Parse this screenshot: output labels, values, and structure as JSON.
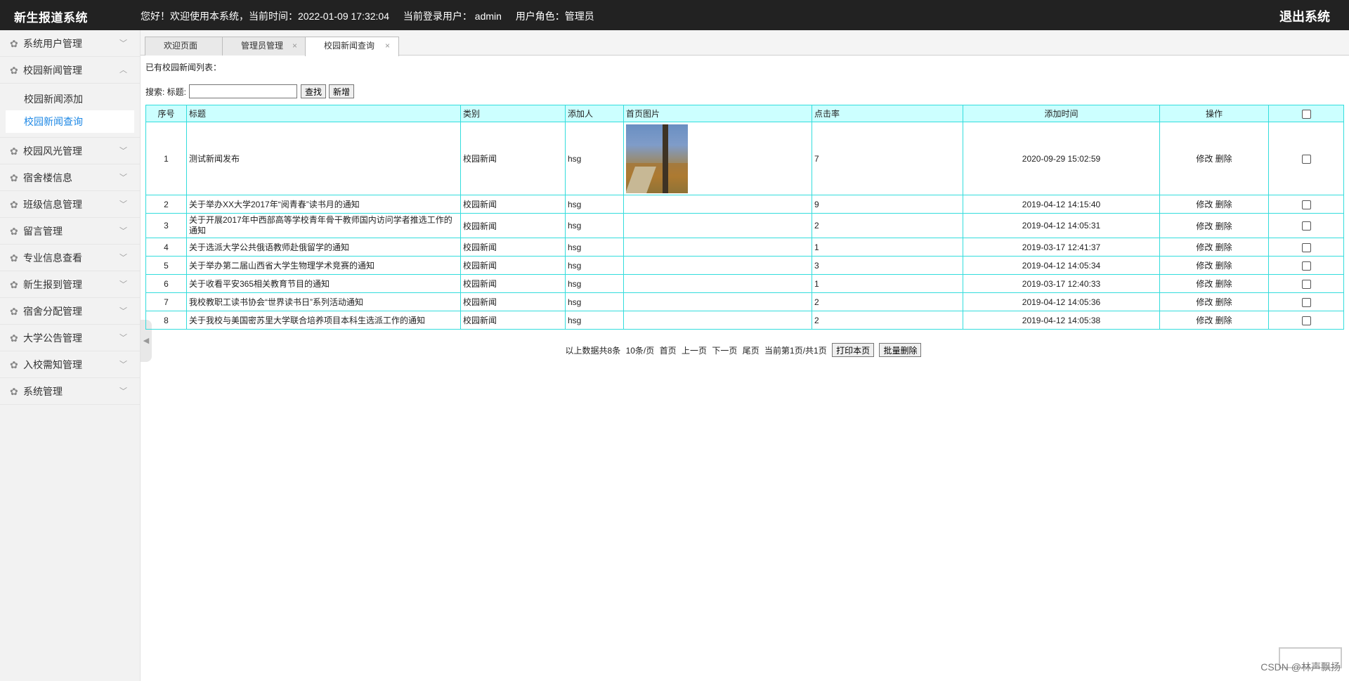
{
  "header": {
    "brand": "新生报道系统",
    "greeting": "您好！欢迎使用本系统，当前时间：2022-01-09 17:32:04",
    "user": "当前登录用户： admin",
    "role": "用户角色：管理员",
    "logout": "退出系统"
  },
  "sidebar": {
    "items": [
      {
        "label": "系统用户管理"
      },
      {
        "label": "校园新闻管理",
        "sub": [
          "校园新闻添加",
          "校园新闻查询"
        ]
      },
      {
        "label": "校园风光管理"
      },
      {
        "label": "宿舍楼信息"
      },
      {
        "label": "班级信息管理"
      },
      {
        "label": "留言管理"
      },
      {
        "label": "专业信息查看"
      },
      {
        "label": "新生报到管理"
      },
      {
        "label": "宿舍分配管理"
      },
      {
        "label": "大学公告管理"
      },
      {
        "label": "入校需知管理"
      },
      {
        "label": "系统管理"
      }
    ]
  },
  "tabs": [
    {
      "label": "欢迎页面"
    },
    {
      "label": "管理员管理"
    },
    {
      "label": "校园新闻查询"
    }
  ],
  "main": {
    "caption": "已有校园新闻列表：",
    "search_label": "搜索: 标题:",
    "search_value": "",
    "find_button": "查找",
    "add_button": "新增"
  },
  "table": {
    "headers": [
      "序号",
      "标题",
      "类别",
      "添加人",
      "首页图片",
      "点击率",
      "添加时间",
      "操作"
    ],
    "rows": [
      {
        "no": "1",
        "title": "测试新闻发布",
        "category": "校园新闻",
        "adder": "hsg",
        "clicks": "7",
        "time": "2020-09-29 15:02:59"
      },
      {
        "no": "2",
        "title": "关于举办XX大学2017年“阅青春”读书月的通知",
        "category": "校园新闻",
        "adder": "hsg",
        "clicks": "9",
        "time": "2019-04-12 14:15:40"
      },
      {
        "no": "3",
        "title": "关于开展2017年中西部高等学校青年骨干教师国内访问学者推选工作的通知",
        "category": "校园新闻",
        "adder": "hsg",
        "clicks": "2",
        "time": "2019-04-12 14:05:31"
      },
      {
        "no": "4",
        "title": "关于选派大学公共俄语教师赴俄留学的通知",
        "category": "校园新闻",
        "adder": "hsg",
        "clicks": "1",
        "time": "2019-03-17 12:41:37"
      },
      {
        "no": "5",
        "title": "关于举办第二届山西省大学生物理学术竞赛的通知",
        "category": "校园新闻",
        "adder": "hsg",
        "clicks": "3",
        "time": "2019-04-12 14:05:34"
      },
      {
        "no": "6",
        "title": "关于收看平安365相关教育节目的通知",
        "category": "校园新闻",
        "adder": "hsg",
        "clicks": "1",
        "time": "2019-03-17 12:40:33"
      },
      {
        "no": "7",
        "title": "我校教职工读书协会“世界读书日”系列活动通知",
        "category": "校园新闻",
        "adder": "hsg",
        "clicks": "2",
        "time": "2019-04-12 14:05:36"
      },
      {
        "no": "8",
        "title": "关于我校与美国密苏里大学联合培养项目本科生选派工作的通知",
        "category": "校园新闻",
        "adder": "hsg",
        "clicks": "2",
        "time": "2019-04-12 14:05:38"
      }
    ],
    "edit_label": "修改",
    "delete_label": "删除"
  },
  "pager": {
    "summary": "以上数据共8条",
    "per_page": "10条/页",
    "first": "首页",
    "prev": "上一页",
    "next": "下一页",
    "last": "尾页",
    "current": "当前第1页/共1页",
    "print_button": "打印本页",
    "batch_delete_button": "批量删除"
  },
  "watermark": "CSDN @林声飘扬"
}
